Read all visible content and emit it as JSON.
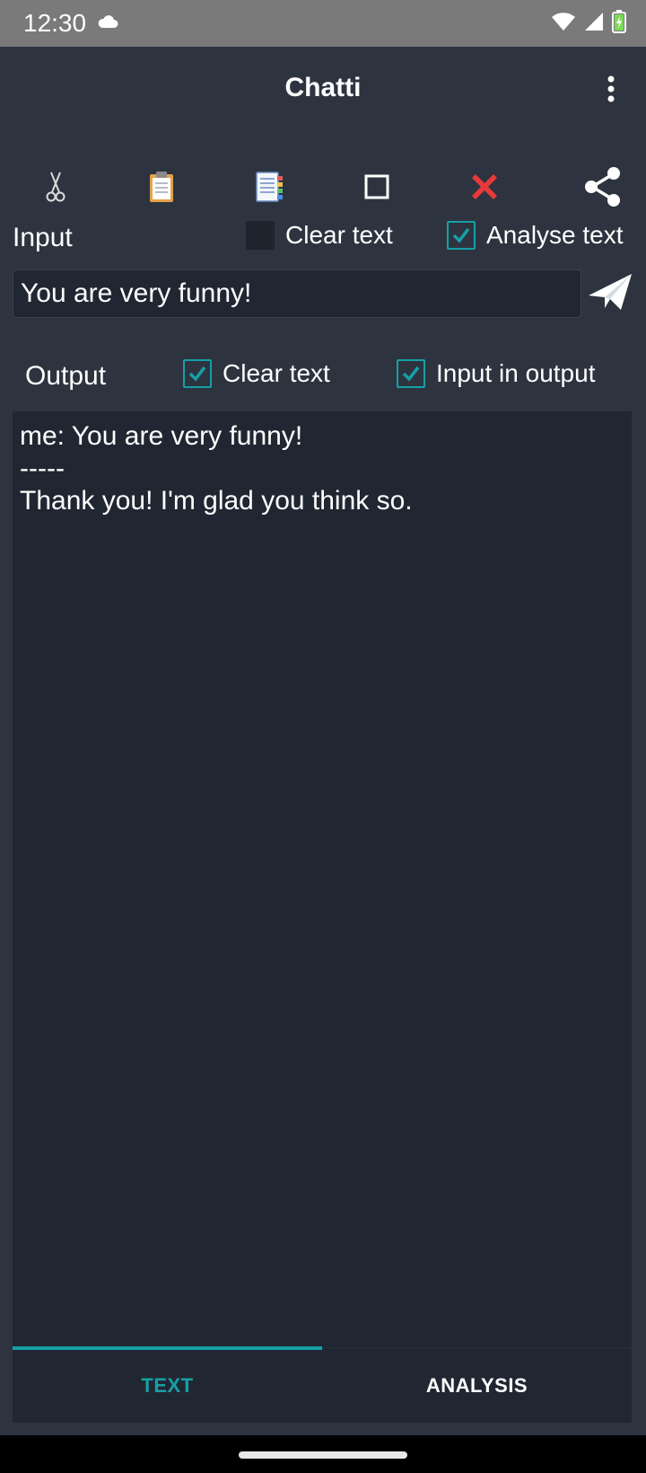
{
  "status_bar": {
    "time": "12:30",
    "icons": [
      "cloud-icon",
      "wifi-icon",
      "cell-signal-icon",
      "battery-charging-icon"
    ]
  },
  "app_bar": {
    "title": "Chatti",
    "overflow_icon": "more-vert-icon"
  },
  "toolbar": {
    "items": [
      {
        "name": "cut",
        "icon": "scissors-icon"
      },
      {
        "name": "paste",
        "icon": "clipboard-icon"
      },
      {
        "name": "copy",
        "icon": "notes-icon"
      },
      {
        "name": "select-all",
        "icon": "square-icon"
      },
      {
        "name": "delete",
        "icon": "red-x-icon"
      },
      {
        "name": "share",
        "icon": "share-icon"
      }
    ]
  },
  "input_section": {
    "label": "Input",
    "clear_text": {
      "label": "Clear text",
      "checked": false
    },
    "analyse_text": {
      "label": "Analyse text",
      "checked": true
    },
    "field_value": "You are very funny!",
    "send_icon": "send-icon"
  },
  "output_section": {
    "label": "Output",
    "clear_text": {
      "label": "Clear text",
      "checked": true
    },
    "input_in_output": {
      "label": "Input in output",
      "checked": true
    },
    "lines": [
      "me: You are very funny!",
      "-----",
      "Thank you! I'm glad you think so."
    ]
  },
  "tabs": [
    {
      "label": "TEXT",
      "active": true
    },
    {
      "label": "ANALYSIS",
      "active": false
    }
  ],
  "colors": {
    "accent": "#16a0a6",
    "background": "#2d3440",
    "field": "#212732",
    "status_bar": "#7a7a7a"
  }
}
